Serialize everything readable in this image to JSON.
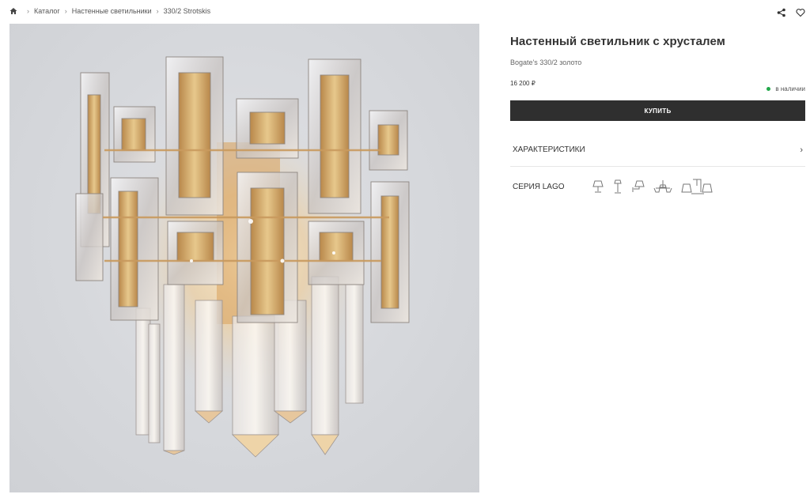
{
  "breadcrumb": {
    "home_icon": "home-icon",
    "items": [
      "Каталог",
      "Настенные светильники",
      "330/2 Strotskis"
    ]
  },
  "actions": {
    "share_icon": "share-icon",
    "favorite_icon": "heart-icon"
  },
  "product": {
    "title": "Настенный светильник с хрусталем",
    "subtitle": "Bogate's 330/2 золото",
    "price": "16 200 ₽",
    "stock": "в наличии",
    "stock_color": "#22a84a",
    "buy_label": "КУПИТЬ",
    "specs_label": "ХАРАКТЕРИСТИКИ",
    "series_label": "СЕРИЯ LAGO",
    "series_icons": [
      "table-lamp-icon",
      "floor-lamp-icon",
      "wall-sconce-icon",
      "chandelier-icon",
      "lamp-set-icon"
    ]
  },
  "colors": {
    "button_bg": "#2f2f2f",
    "photo_bg": "#d6d8dc",
    "gold": "#c9a25a"
  }
}
